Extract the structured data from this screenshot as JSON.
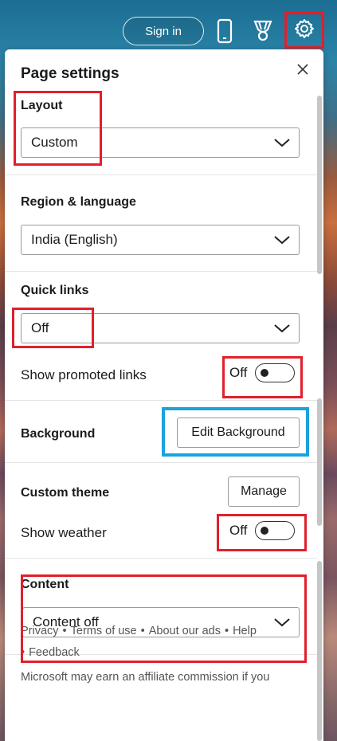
{
  "topbar": {
    "sign_in_label": "Sign in",
    "icons": [
      "phone-icon",
      "trophy-icon",
      "gear-icon"
    ]
  },
  "panel": {
    "title": "Page settings",
    "close_icon": "close-icon"
  },
  "layout": {
    "label": "Layout",
    "selected": "Custom"
  },
  "region": {
    "label": "Region & language",
    "selected": "India (English)"
  },
  "quick_links": {
    "label": "Quick links",
    "selected": "Off"
  },
  "promoted": {
    "label": "Show promoted links",
    "state": "Off"
  },
  "background": {
    "label": "Background",
    "button": "Edit Background"
  },
  "custom_theme": {
    "label": "Custom theme",
    "button": "Manage"
  },
  "weather": {
    "label": "Show weather",
    "state": "Off"
  },
  "content": {
    "label": "Content",
    "selected": "Content off"
  },
  "footer": {
    "links": [
      "Privacy",
      "Terms of use",
      "About our ads",
      "Help",
      "Feedback"
    ],
    "separator": "•",
    "note": "Microsoft may earn an affiliate commission if you"
  },
  "colors": {
    "highlight_red": "#e0202b",
    "highlight_blue": "#1aa3dc"
  }
}
